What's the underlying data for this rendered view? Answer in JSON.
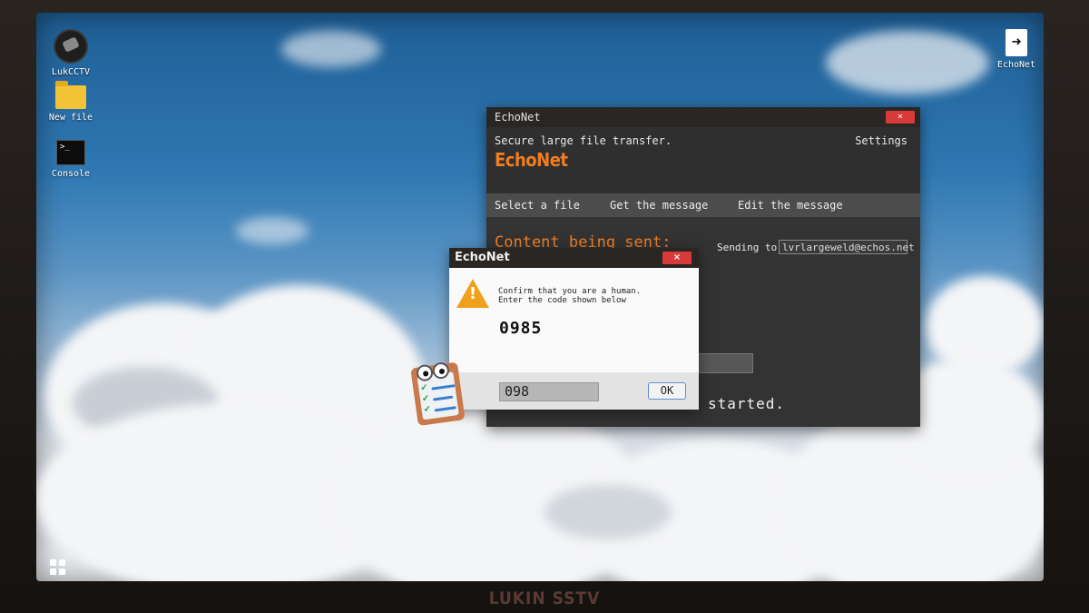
{
  "monitor": {
    "brand": "LUKIN SSTV"
  },
  "desktop": {
    "icons": [
      {
        "label": "LukCCTV",
        "icon": "cctv-camera-icon"
      },
      {
        "label": "New file",
        "icon": "folder-icon"
      },
      {
        "label": "Console",
        "icon": "terminal-icon"
      },
      {
        "label": "EchoNet",
        "icon": "exit-arrow-icon"
      }
    ]
  },
  "main_window": {
    "title": "EchoNet",
    "close": "×",
    "subtitle": "Secure large file transfer.",
    "settings": "Settings",
    "logo": "EchoNet",
    "tabs": [
      "Select a file",
      "Get the message",
      "Edit the message"
    ],
    "content_title": "Content being sent:",
    "sending_label": "Sending to:",
    "sending_value": "lvrlargeweld@echos.net",
    "status": "started."
  },
  "dialog": {
    "title": "EchoNet",
    "close": "×",
    "message_line1": "Confirm that you are a human.",
    "message_line2": "Enter the code shown below",
    "code": "0985",
    "input_value": "098",
    "ok": "OK"
  },
  "colors": {
    "accent": "#f07d1e",
    "close": "#d83a3a",
    "warning": "#f0a01c"
  }
}
